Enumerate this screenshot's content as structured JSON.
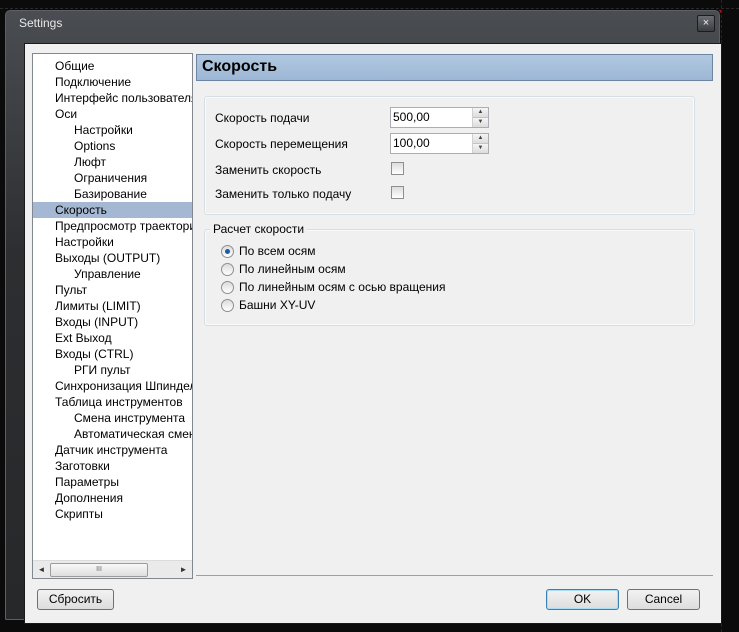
{
  "window": {
    "title": "Settings",
    "close_glyph": "×"
  },
  "tree": {
    "items": [
      {
        "label": "Общие",
        "level": 0
      },
      {
        "label": "Подключение",
        "level": 0
      },
      {
        "label": "Интерфейс пользователя",
        "level": 0
      },
      {
        "label": "Оси",
        "level": 0
      },
      {
        "label": "Настройки",
        "level": 1
      },
      {
        "label": "Options",
        "level": 1
      },
      {
        "label": "Люфт",
        "level": 1
      },
      {
        "label": "Ограничения",
        "level": 1
      },
      {
        "label": "Базирование",
        "level": 1
      },
      {
        "label": "Скорость",
        "level": 0,
        "selected": true
      },
      {
        "label": "Предпросмотр траектории",
        "level": 0
      },
      {
        "label": "Настройки",
        "level": 0
      },
      {
        "label": "Выходы (OUTPUT)",
        "level": 0
      },
      {
        "label": "Управление",
        "level": 1
      },
      {
        "label": "Пульт",
        "level": 0
      },
      {
        "label": "Лимиты (LIMIT)",
        "level": 0
      },
      {
        "label": "Входы (INPUT)",
        "level": 0
      },
      {
        "label": "Ext Выход",
        "level": 0
      },
      {
        "label": "Входы (CTRL)",
        "level": 0
      },
      {
        "label": "РГИ пульт",
        "level": 1
      },
      {
        "label": "Синхронизация Шпинделя",
        "level": 0
      },
      {
        "label": "Таблица инструментов",
        "level": 0
      },
      {
        "label": "Смена инструмента",
        "level": 1
      },
      {
        "label": "Автоматическая смена",
        "level": 1
      },
      {
        "label": "Датчик инструмента",
        "level": 0
      },
      {
        "label": "Заготовки",
        "level": 0
      },
      {
        "label": "Параметры",
        "level": 0
      },
      {
        "label": "Дополнения",
        "level": 0
      },
      {
        "label": "Скрипты",
        "level": 0
      }
    ],
    "scroll": {
      "left_arrow": "◄",
      "right_arrow": "►",
      "thumb_grip": "III"
    }
  },
  "panel": {
    "title": "Скорость",
    "feed_rate_label": "Скорость подачи",
    "feed_rate_value": "500,00",
    "travel_rate_label": "Скорость перемещения",
    "travel_rate_value": "100,00",
    "replace_speed_label": "Заменить скорость",
    "replace_speed_checked": false,
    "replace_feed_only_label": "Заменить только подачу",
    "replace_feed_only_checked": false,
    "spin_up": "▲",
    "spin_down": "▼",
    "calc_group_title": "Расчет скорости",
    "calc_options": [
      {
        "label": "По всем осям",
        "checked": true
      },
      {
        "label": "По линейным осям",
        "checked": false
      },
      {
        "label": "По линейным осям с осью вращения",
        "checked": false
      },
      {
        "label": "Башни XY-UV",
        "checked": false
      }
    ]
  },
  "footer": {
    "reset_label": "Сбросить",
    "ok_label": "OK",
    "cancel_label": "Cancel"
  }
}
